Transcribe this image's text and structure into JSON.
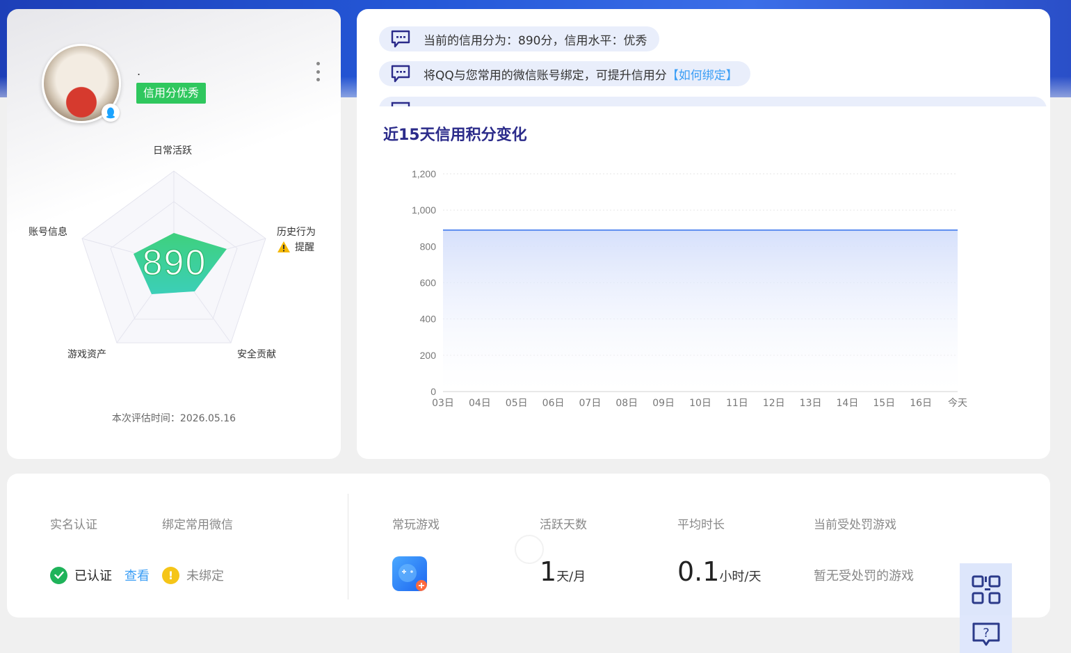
{
  "profile": {
    "username": ".",
    "credit_tag": "信用分优秀",
    "score": "890",
    "radar": {
      "top": "日常活跃",
      "right": "历史行为",
      "right_warning": "提醒",
      "bottom_right": "安全贡献",
      "bottom_left": "游戏资产",
      "left": "账号信息",
      "levels": {
        "daily_active": 0.4,
        "history": 0.45,
        "security": 0.3,
        "assets": 0.3,
        "account": 0.3
      }
    },
    "eval_time_label": "本次评估时间：",
    "eval_time_value": "2026.05.16"
  },
  "notices": [
    {
      "text": "当前的信用分为：890分，信用水平：优秀",
      "link": ""
    },
    {
      "text": "将QQ与您常用的微信账号绑定，可提升信用分",
      "link": "【如何绑定】"
    }
  ],
  "chart_section_title": "近15天信用积分变化",
  "chart_data": {
    "type": "area",
    "title": "近15天信用积分变化",
    "x": [
      "03日",
      "04日",
      "05日",
      "06日",
      "07日",
      "08日",
      "09日",
      "10日",
      "11日",
      "12日",
      "13日",
      "14日",
      "15日",
      "16日",
      "今天"
    ],
    "series": [
      {
        "values": [
          890,
          890,
          890,
          890,
          890,
          890,
          890,
          890,
          890,
          890,
          890,
          890,
          890,
          890,
          890
        ]
      }
    ],
    "yticks": [
      "0",
      "200",
      "400",
      "600",
      "800",
      "1,000",
      "1,200"
    ],
    "ylim": [
      0,
      1200
    ],
    "xlabel": "",
    "ylabel": "",
    "grid": true,
    "colors": {
      "line": "#5b8def",
      "fill_top": "#d6e0fb"
    }
  },
  "stats": {
    "realname_head": "实名认证",
    "wechat_head": "绑定常用微信",
    "realname_status": "已认证",
    "realname_link": "查看",
    "wechat_status": "未绑定",
    "games_head": "常玩游戏",
    "active_days_head": "活跃天数",
    "active_days_value": "1",
    "active_days_unit": "天/月",
    "avg_time_head": "平均时长",
    "avg_time_value": "0.1",
    "avg_time_unit": "小时/天",
    "penalty_head": "当前受处罚游戏",
    "penalty_value": "暂无受处罚的游戏"
  },
  "icons": {
    "more": "more-vertical-icon",
    "qq": "qq-penguin-icon",
    "warning": "warning-triangle-icon",
    "message": "message-bubble-icon",
    "check": "check-circle-icon",
    "exclaim": "exclamation-circle-icon",
    "game": "game-controller-icon",
    "qrcode": "qrcode-icon",
    "help": "help-chat-icon"
  },
  "colors": {
    "brand_blue": "#2458d8",
    "tag_green": "#2fc75e",
    "link_blue": "#3b9ef5",
    "radar_green": "#3ad18a",
    "title_navy": "#2b2b8a"
  }
}
